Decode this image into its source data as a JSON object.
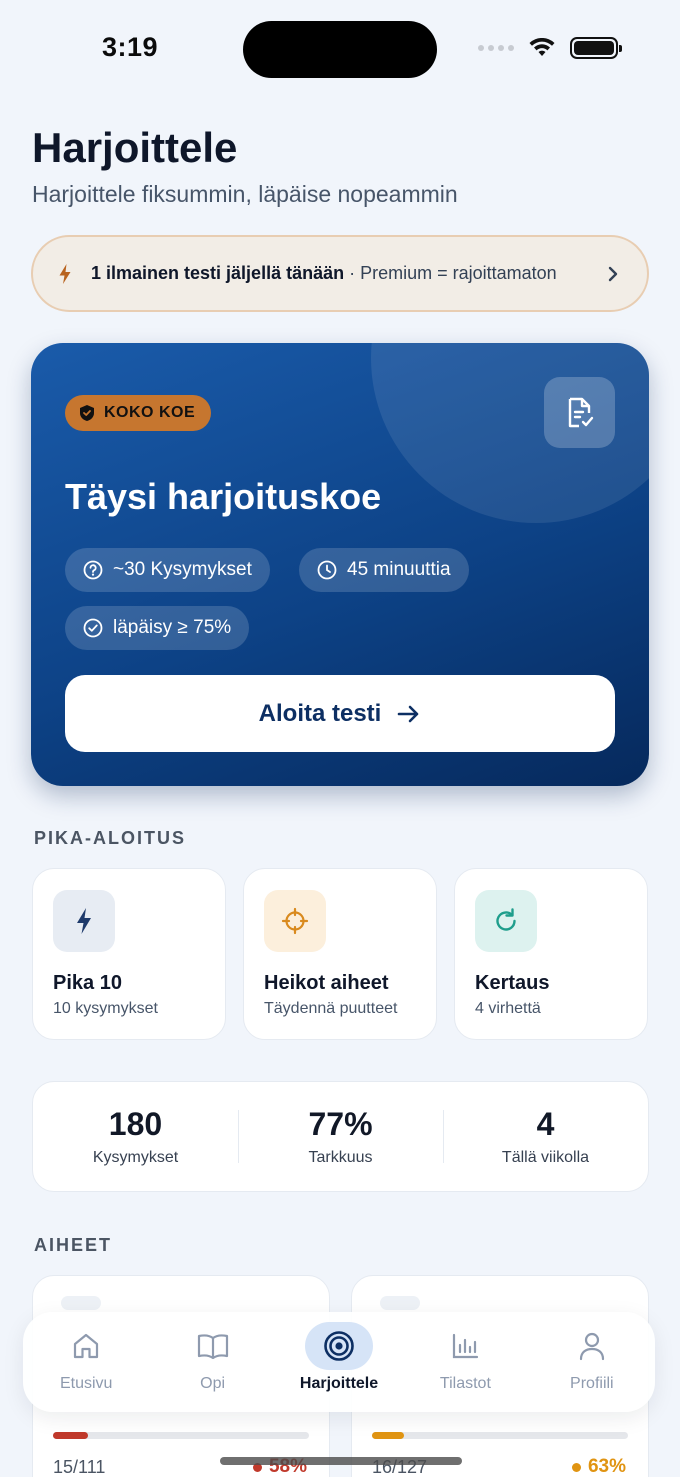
{
  "status_bar": {
    "time": "3:19"
  },
  "header": {
    "title": "Harjoittele",
    "subtitle": "Harjoittele fiksummin, läpäise nopeammin"
  },
  "banner": {
    "bold_text": "1 ilmainen testi jäljellä tänään",
    "separator": " · ",
    "rest_text": "Premium = rajoittamaton"
  },
  "hero": {
    "badge": "KOKO KOE",
    "title": "Täysi harjoituskoe",
    "chips": [
      "~30 Kysymykset",
      "45 minuuttia",
      "läpäisy ≥ 75%"
    ],
    "start_label": "Aloita testi"
  },
  "quick_start": {
    "label": "PIKA-ALOITUS",
    "items": [
      {
        "title": "Pika 10",
        "subtitle": "10 kysymykset",
        "icon": "lightning-icon",
        "color": "#1E3A6B",
        "bg": "#E7ECF3"
      },
      {
        "title": "Heikot aiheet",
        "subtitle": "Täydennä puutteet",
        "icon": "crosshair-icon",
        "color": "#D98A1E",
        "bg": "#FCEFDC"
      },
      {
        "title": "Kertaus",
        "subtitle": "4 virhettä",
        "icon": "refresh-icon",
        "color": "#1F9E8C",
        "bg": "#DDF2EF"
      }
    ]
  },
  "stats": [
    {
      "value": "180",
      "label": "Kysymykset"
    },
    {
      "value": "77%",
      "label": "Tarkkuus"
    },
    {
      "value": "4",
      "label": "Tällä viikolla"
    }
  ],
  "topics": {
    "label": "AIHEET",
    "items": [
      {
        "count": "15/111",
        "percent": "58%",
        "progress": 0.135,
        "color": "#C0392B"
      },
      {
        "count": "16/127",
        "percent": "63%",
        "progress": 0.126,
        "color": "#E09412"
      }
    ]
  },
  "tab_bar": {
    "items": [
      {
        "label": "Etusivu",
        "icon": "home-icon"
      },
      {
        "label": "Opi",
        "icon": "book-icon"
      },
      {
        "label": "Harjoittele",
        "icon": "target-icon",
        "active": true
      },
      {
        "label": "Tilastot",
        "icon": "bar-chart-icon"
      },
      {
        "label": "Profiili",
        "icon": "user-icon"
      }
    ]
  },
  "colors": {
    "accent": "#0D4286",
    "badge": "#C6762F",
    "background": "#F1F5FB"
  }
}
